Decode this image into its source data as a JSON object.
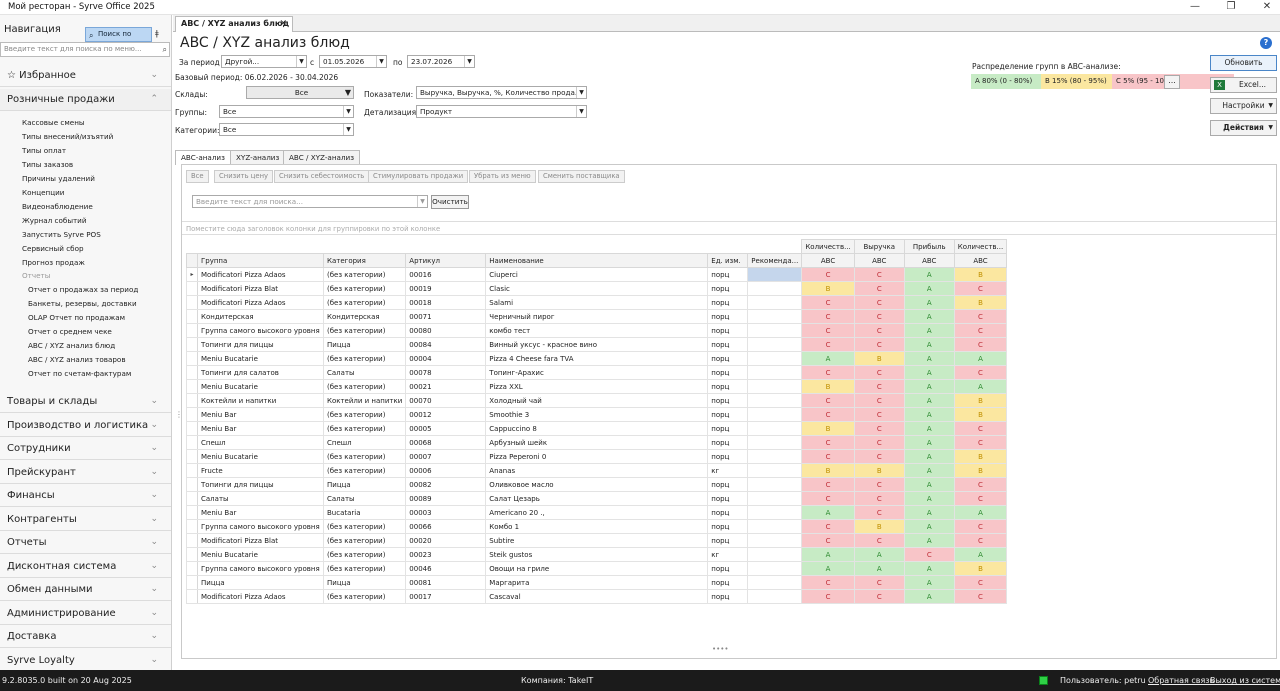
{
  "window": {
    "title": "Мой ресторан - Syrve Office 2025",
    "controls": [
      "—",
      "❐",
      "✕"
    ]
  },
  "nav": {
    "header": "Навигация",
    "menu_search_btn": "Поиск по меню",
    "search_placeholder": "Введите текст для поиска по меню...",
    "favorites": "Избранное",
    "retail": "Розничные продажи",
    "retail_items": [
      "Кассовые смены",
      "Типы внесений/изъятий",
      "Типы оплат",
      "Типы заказов",
      "Причины удалений",
      "Концепции",
      "Видеонаблюдение",
      "Журнал событий",
      "Запустить Syrve POS",
      "Сервисный сбор",
      "Прогноз продаж"
    ],
    "reports_group": "Отчеты",
    "report_items": [
      "Отчет о продажах за период",
      "Банкеты, резервы, доставки",
      "OLAP Отчет по продажам",
      "Отчет о среднем чеке",
      "ABC / XYZ анализ блюд",
      "ABC / XYZ анализ товаров",
      "Отчет по счетам-фактурам"
    ],
    "sections": [
      "Товары и склады",
      "Производство и логистика",
      "Сотрудники",
      "Прейскурант",
      "Финансы",
      "Контрагенты",
      "Отчеты",
      "Дисконтная система",
      "Обмен данными",
      "Администрирование",
      "Доставка",
      "Syrve Loyalty"
    ]
  },
  "doc": {
    "tab": "ABC / XYZ анализ блюд",
    "title": "ABC / XYZ анализ блюд",
    "period_label": "За период",
    "period_value": "Другой...",
    "from_label": "с",
    "from_date": "01.05.2026",
    "to_label": "по",
    "to_date": "23.07.2026",
    "base_period": "Базовый период: 06.02.2026 - 30.04.2026",
    "warehouses_label": "Склады:",
    "warehouses_value": "Все",
    "groups_label": "Группы:",
    "groups_value": "Все",
    "categories_label": "Категории:",
    "categories_value": "Все",
    "indicators_label": "Показатели:",
    "indicators_value": "Выручка, Выручка, %, Количество прода...",
    "detail_label": "Детализация:",
    "detail_value": "Продукт",
    "abc_dist_label": "Распределение групп в ABC-анализе:",
    "abc_dist": [
      {
        "text": "A 80% (0 - 80%)",
        "color": "#c7ebc5"
      },
      {
        "text": "B 15% (80 - 95%)",
        "color": "#fbe7a0"
      },
      {
        "text": "C 5% (95 - 100%)",
        "color": "#f8c5c8"
      }
    ],
    "dist_more": "...",
    "btn_refresh": "Обновить",
    "btn_excel": "Excel...",
    "btn_settings": "Настройки",
    "btn_actions": "Действия"
  },
  "subtabs": [
    "ABC-анализ",
    "XYZ-анализ",
    "ABC / XYZ-анализ"
  ],
  "toolbar": [
    "Все",
    "Снизить цену",
    "Снизить себестоимость",
    "Стимулировать продажи",
    "Убрать из меню",
    "Сменить поставщика"
  ],
  "grid_search_placeholder": "Введите текст для поиска...",
  "clear_btn": "Очистить",
  "group_hint": "Поместите сюда заголовок колонки для группировки по этой колонке",
  "columns": {
    "group": "Группа",
    "category": "Категория",
    "article": "Артикул",
    "name": "Наименование",
    "unit": "Ед. изм.",
    "recommend": "Рекоменда...",
    "metrics": [
      "Количеств...",
      "Выручка",
      "Прибыль",
      "Количеств..."
    ],
    "abc": "ABC"
  },
  "rows": [
    [
      "Modificatori Pizza Adaos",
      "(без категории)",
      "00016",
      "Ciuperci",
      "порц",
      "C",
      "C",
      "A",
      "B"
    ],
    [
      "Modificatori Pizza Blat",
      "(без категории)",
      "00019",
      "Clasic",
      "порц",
      "B",
      "C",
      "A",
      "C"
    ],
    [
      "Modificatori Pizza Adaos",
      "(без категории)",
      "00018",
      "Salami",
      "порц",
      "C",
      "C",
      "A",
      "B"
    ],
    [
      "Кондитерская",
      "Кондитерская",
      "00071",
      "Черничный пирог",
      "порц",
      "C",
      "C",
      "A",
      "C"
    ],
    [
      "Группа самого высокого уровня",
      "(без категории)",
      "00080",
      "комбо тест",
      "порц",
      "C",
      "C",
      "A",
      "C"
    ],
    [
      "Топинги для пиццы",
      "Пицца",
      "00084",
      "Винный уксус - красное вино",
      "порц",
      "C",
      "C",
      "A",
      "C"
    ],
    [
      "Meniu Bucatarie",
      "(без категории)",
      "00004",
      "Pizza 4 Cheese fara TVA",
      "порц",
      "A",
      "B",
      "A",
      "A"
    ],
    [
      "Топинги для салатов",
      "Салаты",
      "00078",
      "Топинг-Арахис",
      "порц",
      "C",
      "C",
      "A",
      "C"
    ],
    [
      "Meniu Bucatarie",
      "(без категории)",
      "00021",
      "Pizza XXL",
      "порц",
      "B",
      "C",
      "A",
      "A"
    ],
    [
      "Коктейли и напитки",
      "Коктейли и напитки",
      "00070",
      "Холодный чай",
      "порц",
      "C",
      "C",
      "A",
      "B"
    ],
    [
      "Meniu Bar",
      "(без категории)",
      "00012",
      "Smoothie 3",
      "порц",
      "C",
      "C",
      "A",
      "B"
    ],
    [
      "Meniu Bar",
      "(без категории)",
      "00005",
      "Cappuccino 8",
      "порц",
      "B",
      "C",
      "A",
      "C"
    ],
    [
      "Спешл",
      "Спешл",
      "00068",
      "Арбузный шейк",
      "порц",
      "C",
      "C",
      "A",
      "C"
    ],
    [
      "Meniu Bucatarie",
      "(без категории)",
      "00007",
      "Pizza Peperoni 0",
      "порц",
      "C",
      "C",
      "A",
      "B"
    ],
    [
      "Fructe",
      "(без категории)",
      "00006",
      "Ananas",
      "кг",
      "B",
      "B",
      "A",
      "B"
    ],
    [
      "Топинги для пиццы",
      "Пицца",
      "00082",
      "Оливковое масло",
      "порц",
      "C",
      "C",
      "A",
      "C"
    ],
    [
      "Салаты",
      "Салаты",
      "00089",
      "Салат Цезарь",
      "порц",
      "C",
      "C",
      "A",
      "C"
    ],
    [
      "Meniu Bar",
      "Bucataria",
      "00003",
      "Americano 20 .,",
      "порц",
      "A",
      "C",
      "A",
      "A"
    ],
    [
      "Группа самого высокого уровня",
      "(без категории)",
      "00066",
      "Комбо 1",
      "порц",
      "C",
      "B",
      "A",
      "C"
    ],
    [
      "Modificatori Pizza Blat",
      "(без категории)",
      "00020",
      "Subtire",
      "порц",
      "C",
      "C",
      "A",
      "C"
    ],
    [
      "Meniu Bucatarie",
      "(без категории)",
      "00023",
      "Steik gustos",
      "кг",
      "A",
      "A",
      "C",
      "A"
    ],
    [
      "Группа самого высокого уровня",
      "(без категории)",
      "00046",
      "Овощи на гриле",
      "порц",
      "A",
      "A",
      "A",
      "B"
    ],
    [
      "Пицца",
      "Пицца",
      "00081",
      "Маргарита",
      "порц",
      "C",
      "C",
      "A",
      "C"
    ],
    [
      "Modificatori Pizza Adaos",
      "(без категории)",
      "00017",
      "Cascaval",
      "порц",
      "C",
      "C",
      "A",
      "C"
    ]
  ],
  "status": {
    "build": "9.2.8035.0 built on 20 Aug 2025",
    "company": "Компания: TakeIT",
    "user": "Пользователь: petru",
    "feedback": "Обратная связь",
    "logout": "Выход из системы"
  }
}
